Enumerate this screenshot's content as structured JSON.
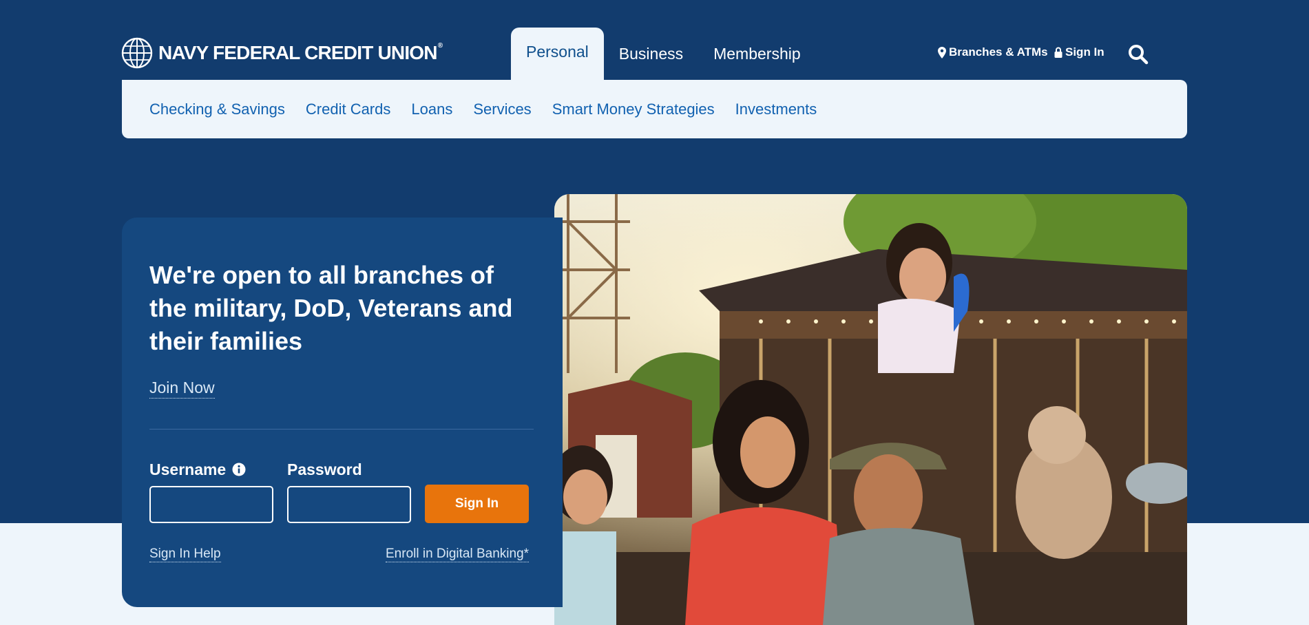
{
  "brand": {
    "name": "NAVY FEDERAL CREDIT UNION",
    "mark": "®"
  },
  "top_tabs": [
    {
      "label": "Personal",
      "active": true
    },
    {
      "label": "Business",
      "active": false
    },
    {
      "label": "Membership",
      "active": false
    }
  ],
  "utility": {
    "branches_label": "Branches & ATMs",
    "sign_in_label": "Sign In",
    "search_icon": "search-icon"
  },
  "subnav": [
    "Checking & Savings",
    "Credit Cards",
    "Loans",
    "Services",
    "Smart Money Strategies",
    "Investments"
  ],
  "hero": {
    "headline": "We're open to all branches of the military, DoD, Veterans and their families",
    "join_label": "Join Now"
  },
  "login": {
    "username_label": "Username",
    "username_value": "",
    "password_label": "Password",
    "password_value": "",
    "sign_in_button": "Sign In",
    "help_link": "Sign In Help",
    "enroll_link": "Enroll in Digital Banking*"
  },
  "colors": {
    "navy": "#123c6e",
    "card": "#15487f",
    "accent_orange": "#e8740c",
    "link_blue": "#1161b0",
    "light_bg": "#eef5fb"
  }
}
